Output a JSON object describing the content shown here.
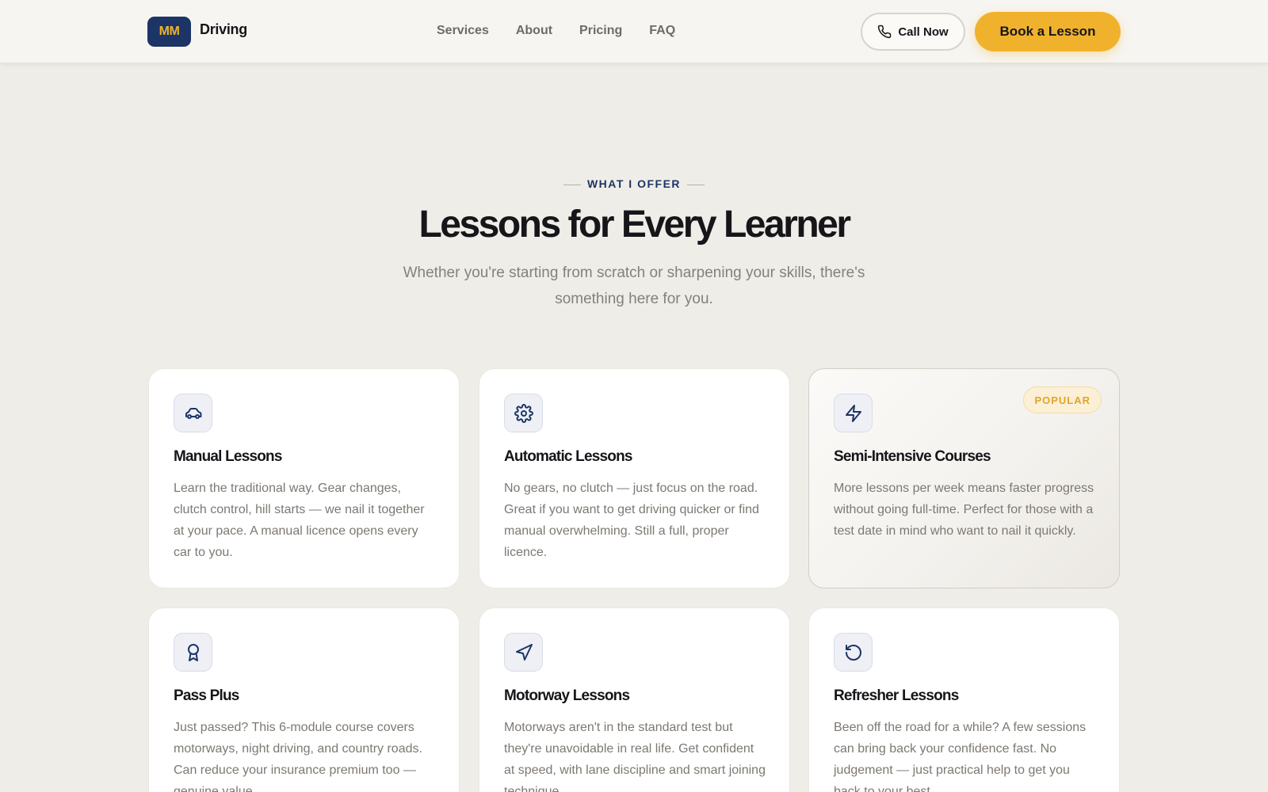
{
  "header": {
    "logo_badge": "MM",
    "logo_text": "Driving",
    "nav": [
      "Services",
      "About",
      "Pricing",
      "FAQ"
    ],
    "call_label": "Call Now",
    "book_label": "Book a Lesson"
  },
  "section": {
    "eyebrow": "WHAT I OFFER",
    "title": "Lessons for Every Learner",
    "subtitle": "Whether you're starting from scratch or sharpening your skills, there's something here for you."
  },
  "cards": [
    {
      "icon": "car-icon",
      "title": "Manual Lessons",
      "desc": "Learn the traditional way. Gear changes, clutch control, hill starts — we nail it together at your pace. A manual licence opens every car to you."
    },
    {
      "icon": "gear-icon",
      "title": "Automatic Lessons",
      "desc": "No gears, no clutch — just focus on the road. Great if you want to get driving quicker or find manual overwhelming. Still a full, proper licence."
    },
    {
      "icon": "lightning-icon",
      "title": "Semi-Intensive Courses",
      "desc": "More lessons per week means faster progress without going full-time. Perfect for those with a test date in mind who want to nail it quickly.",
      "badge": "POPULAR"
    },
    {
      "icon": "award-icon",
      "title": "Pass Plus",
      "desc": "Just passed? This 6-module course covers motorways, night driving, and country roads. Can reduce your insurance premium too — genuine value."
    },
    {
      "icon": "navigation-icon",
      "title": "Motorway Lessons",
      "desc": "Motorways aren't in the standard test but they're unavoidable in real life. Get confident at speed, with lane discipline and smart joining technique."
    },
    {
      "icon": "refresh-icon",
      "title": "Refresher Lessons",
      "desc": "Been off the road for a while? A few sessions can bring back your confidence fast. No judgement — just practical help to get you back to your best."
    }
  ],
  "colors": {
    "navy": "#1c3466",
    "accent": "#f0b22d",
    "background": "#efede8"
  }
}
